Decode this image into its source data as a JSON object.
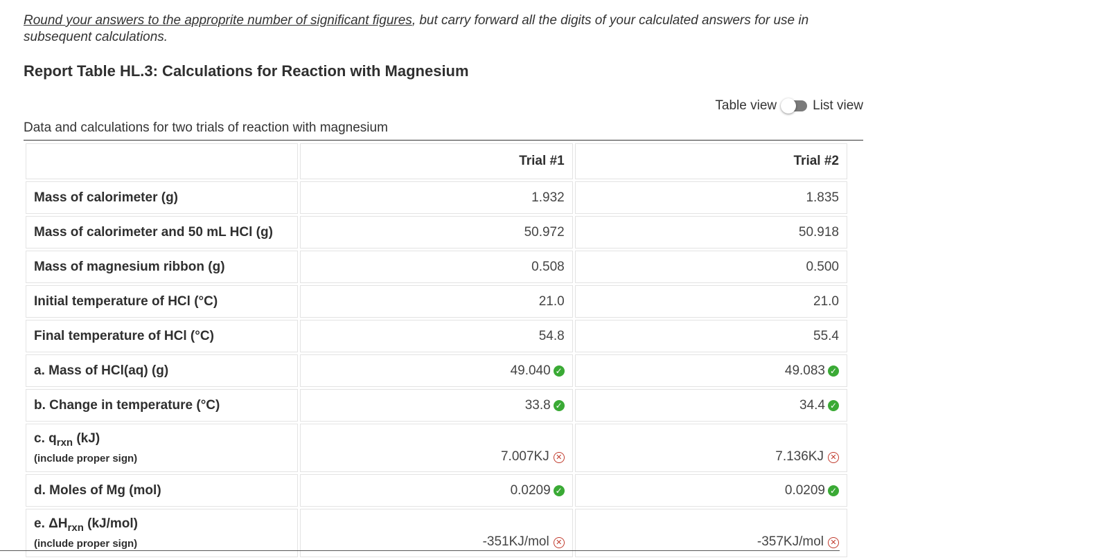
{
  "instructions": {
    "link_text": "Round your answers to the approprite number of significant figures",
    "rest_text": ", but carry forward all the digits of your calculated answers for use in subsequent calculations."
  },
  "report_title": "Report Table HL.3: Calculations for Reaction with Magnesium",
  "view_toggle": {
    "table_label": "Table view",
    "list_label": "List view"
  },
  "caption": "Data and calculations for two trials of reaction with magnesium",
  "table": {
    "headers": [
      "",
      "Trial #1",
      "Trial #2"
    ],
    "rows": [
      {
        "label": "Mass of calorimeter (g)",
        "t1": "1.932",
        "t2": "1.835"
      },
      {
        "label": "Mass of calorimeter and 50 mL HCl (g)",
        "t1": "50.972",
        "t2": "50.918"
      },
      {
        "label": "Mass of magnesium ribbon (g)",
        "t1": "0.508",
        "t2": "0.500"
      },
      {
        "label": "Initial temperature of HCl (°C)",
        "t1": "21.0",
        "t2": "21.0"
      },
      {
        "label": "Final temperature of HCl (°C)",
        "t1": "54.8",
        "t2": "55.4"
      },
      {
        "label": "a. Mass of HCl(aq) (g)",
        "t1": "49.040",
        "t2": "49.083"
      },
      {
        "label": "b. Change in temperature (°C)",
        "t1": "33.8",
        "t2": "34.4"
      },
      {
        "label_pre": "c. q",
        "label_sub": "rxn",
        "label_post": " (kJ)",
        "note": "(include proper sign)",
        "t1": "7.007KJ",
        "t2": "7.136KJ"
      },
      {
        "label": "d. Moles of Mg (mol)",
        "t1": "0.0209",
        "t2": "0.0209"
      },
      {
        "label_pre": "e. ΔH",
        "label_sub": "rxn",
        "label_post": " (kJ/mol)",
        "note": "(include proper sign)",
        "t1": "-351KJ/mol",
        "t2": "-357KJ/mol"
      }
    ]
  },
  "status_colors": {
    "correct": "#3aaa35",
    "incorrect": "#c0392b"
  }
}
